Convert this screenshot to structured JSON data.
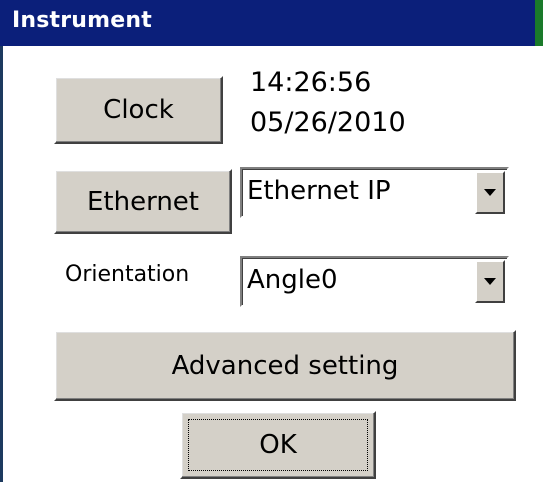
{
  "window": {
    "title": "Instrument",
    "title_bar_color": "#0b1f7a",
    "face_color": "#d4d0c8"
  },
  "clock": {
    "button_label": "Clock",
    "time": "14:26:56",
    "date": "05/26/2010"
  },
  "ethernet": {
    "button_label": "Ethernet",
    "selected": "Ethernet IP"
  },
  "orientation": {
    "label": "Orientation",
    "selected": "Angle0"
  },
  "advanced": {
    "button_label": "Advanced setting"
  },
  "ok": {
    "button_label": "OK"
  },
  "icons": {
    "dropdown": "chevron-down-icon"
  }
}
